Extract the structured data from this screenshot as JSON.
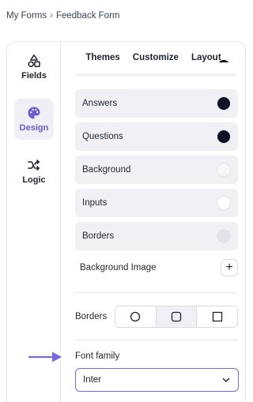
{
  "breadcrumb": {
    "root": "My Forms",
    "separator": "›",
    "current": "Feedback Form"
  },
  "rail": [
    {
      "id": "fields",
      "label": "Fields",
      "icon": "shapes-icon",
      "active": false
    },
    {
      "id": "design",
      "label": "Design",
      "icon": "palette-icon",
      "active": true
    },
    {
      "id": "logic",
      "label": "Logic",
      "icon": "shuffle-icon",
      "active": false
    }
  ],
  "tabs": [
    {
      "label": "Themes",
      "active": false
    },
    {
      "label": "Customize",
      "active": true
    },
    {
      "label": "Layout",
      "active": false
    }
  ],
  "color_rows": [
    {
      "label": "Answers",
      "color": "#0f1222"
    },
    {
      "label": "Questions",
      "color": "#0f1222"
    },
    {
      "label": "Background",
      "color": "#f7f7fa"
    },
    {
      "label": "Inputs",
      "color": "#ffffff"
    },
    {
      "label": "Borders",
      "color": "#e3e4ea"
    }
  ],
  "background_image": {
    "label": "Background Image",
    "action": "+"
  },
  "borders": {
    "label": "Borders",
    "options": [
      "circle-border-icon",
      "rounded-border-icon",
      "square-border-icon"
    ],
    "selected": 1
  },
  "font_family": {
    "label": "Font family",
    "value": "Inter"
  },
  "accent": "#6d5bd0"
}
